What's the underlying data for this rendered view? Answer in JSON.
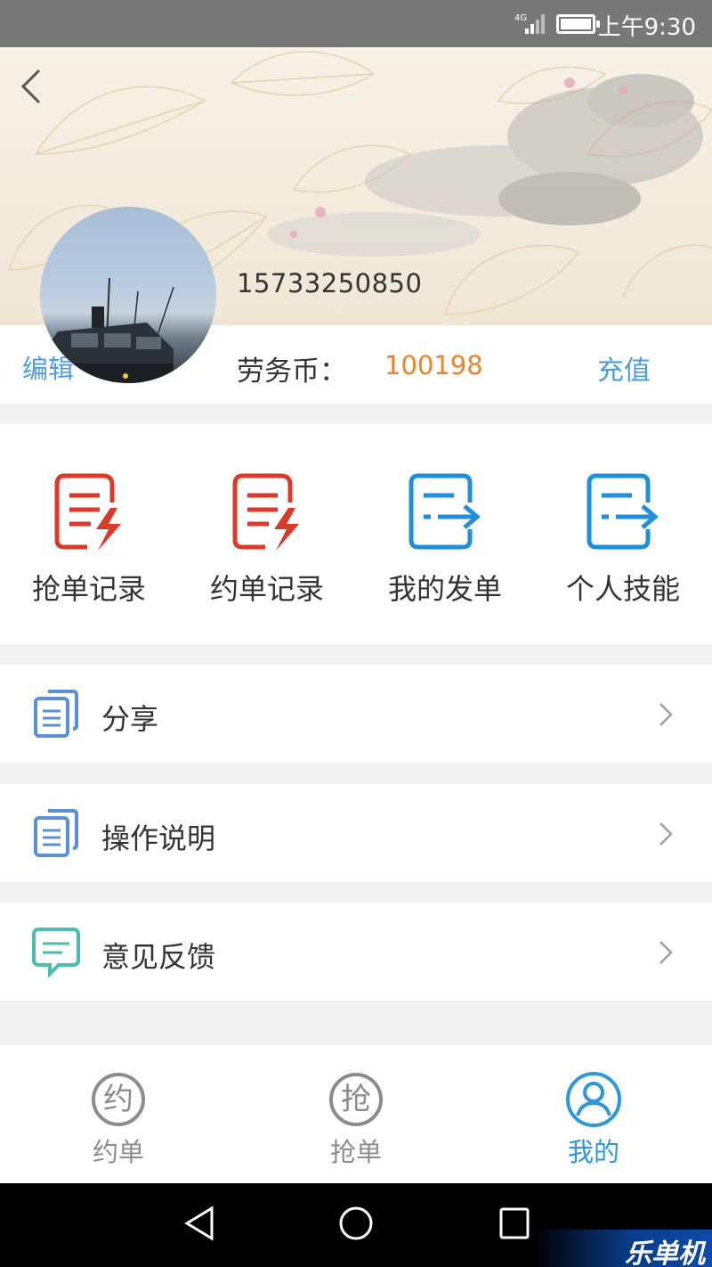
{
  "status_bar": {
    "time": "上午9:30",
    "network": "4G"
  },
  "header": {
    "back_icon": "chevron-left-icon"
  },
  "profile": {
    "phone": "15733250850",
    "edit_label": "编辑",
    "coin_label": "劳务币：",
    "coin_value": "100198",
    "recharge_label": "充值"
  },
  "quick_actions": [
    {
      "label": "抢单记录",
      "icon": "red-document-bolt-icon"
    },
    {
      "label": "约单记录",
      "icon": "red-document-bolt-icon"
    },
    {
      "label": "我的发单",
      "icon": "blue-document-export-icon"
    },
    {
      "label": "个人技能",
      "icon": "blue-document-export-icon"
    }
  ],
  "menu": [
    {
      "label": "分享",
      "icon": "document-stack-icon"
    },
    {
      "label": "操作说明",
      "icon": "document-stack-icon"
    },
    {
      "label": "意见反馈",
      "icon": "chat-bubble-icon"
    }
  ],
  "tabs": [
    {
      "label": "约单",
      "glyph": "约",
      "active": false
    },
    {
      "label": "抢单",
      "glyph": "抢",
      "active": false
    },
    {
      "label": "我的",
      "glyph": "",
      "active": true
    }
  ],
  "watermark": "乐单机",
  "colors": {
    "accent_blue": "#2d97dc",
    "link_blue": "#4a9de0",
    "coin_orange": "#f08228",
    "icon_red": "#d93a2a",
    "icon_blue": "#1e8fd8",
    "inactive_gray": "#8c8c8c"
  }
}
